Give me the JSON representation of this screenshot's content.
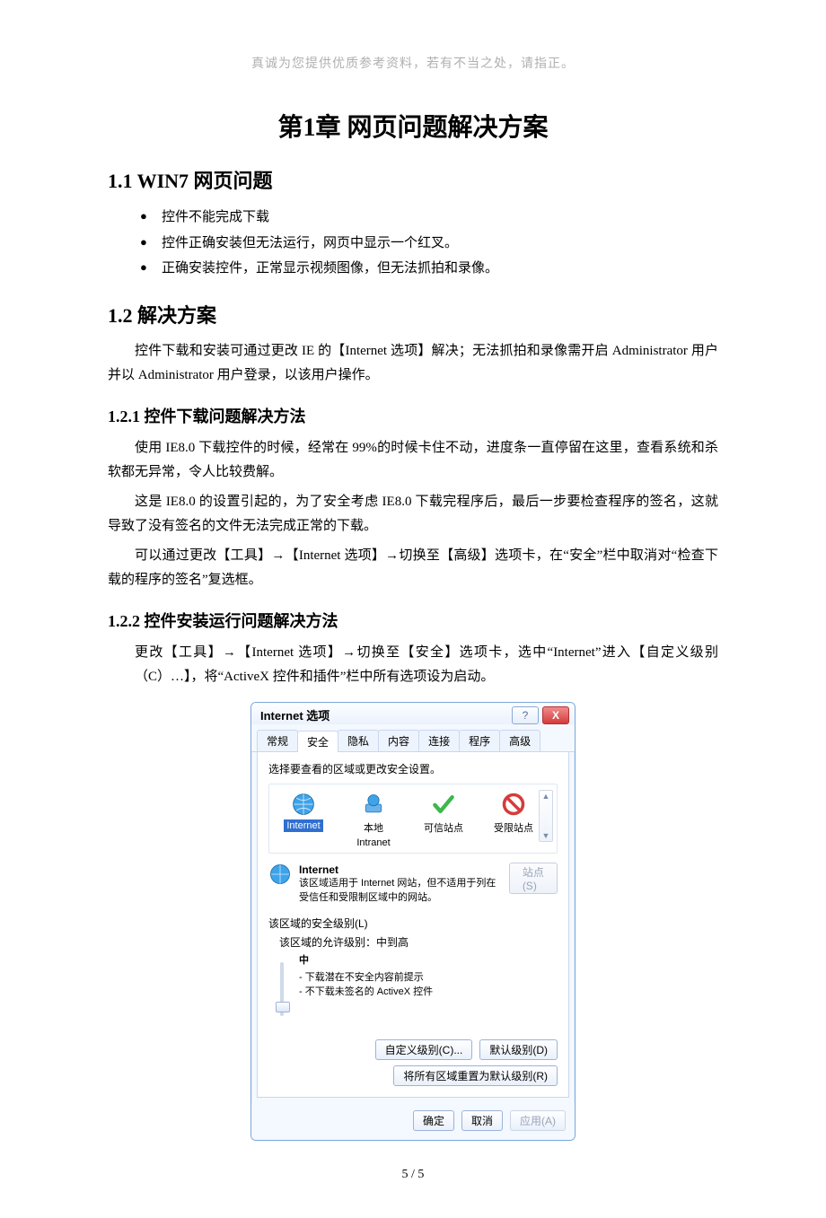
{
  "header_note": "真诚为您提供优质参考资料，若有不当之处，请指正。",
  "chapter_title": "第1章 网页问题解决方案",
  "section_1_1": {
    "heading": "1.1 WIN7 网页问题",
    "bullets": [
      "控件不能完成下载",
      "控件正确安装但无法运行，网页中显示一个红叉。",
      "正确安装控件，正常显示视频图像，但无法抓拍和录像。"
    ]
  },
  "section_1_2": {
    "heading": "1.2 解决方案",
    "intro": "控件下载和安装可通过更改 IE 的【Internet 选项】解决；无法抓拍和录像需开启 Administrator 用户并以 Administrator 用户登录，以该用户操作。"
  },
  "section_1_2_1": {
    "heading": "1.2.1  控件下载问题解决方法",
    "p1": "使用 IE8.0 下载控件的时候，经常在 99%的时候卡住不动，进度条一直停留在这里，查看系统和杀软都无异常，令人比较费解。",
    "p2": "这是 IE8.0 的设置引起的，为了安全考虑 IE8.0 下载完程序后，最后一步要检查程序的签名，这就导致了没有签名的文件无法完成正常的下载。",
    "p3": "可以通过更改【工具】→【Internet 选项】→切换至【高级】选项卡，在“安全”栏中取消对“检查下载的程序的签名”复选框。"
  },
  "section_1_2_2": {
    "heading": "1.2.2  控件安装运行问题解决方法",
    "p1": "更改【工具】→【Internet 选项】→切换至【安全】选项卡，选中“Internet”进入【自定义级别（C）…】，将“ActiveX 控件和插件”栏中所有选项设为启动。"
  },
  "dialog": {
    "title": "Internet 选项",
    "tabs": [
      "常规",
      "安全",
      "隐私",
      "内容",
      "连接",
      "程序",
      "高级"
    ],
    "active_tab_index": 1,
    "zone_label": "选择要查看的区域或更改安全设置。",
    "zones": [
      {
        "label": "Internet",
        "sub": ""
      },
      {
        "label": "本地",
        "sub": "Intranet"
      },
      {
        "label": "可信站点",
        "sub": ""
      },
      {
        "label": "受限站点",
        "sub": ""
      }
    ],
    "selected_zone_index": 0,
    "sites_btn": "站点(S)",
    "zone_desc_title": "Internet",
    "zone_desc_text": "该区域适用于 Internet 网站，但不适用于列在受信任和受限制区域中的网站。",
    "sec_heading": "该区域的安全级别(L)",
    "allowed_levels": "该区域的允许级别：中到高",
    "current_level": "中",
    "level_notes": [
      "- 下载潜在不安全内容前提示",
      "- 不下载未签名的 ActiveX 控件"
    ],
    "btn_custom": "自定义级别(C)...",
    "btn_default": "默认级别(D)",
    "btn_reset_all": "将所有区域重置为默认级别(R)",
    "btn_ok": "确定",
    "btn_cancel": "取消",
    "btn_apply": "应用(A)"
  },
  "page_number": "5 / 5"
}
